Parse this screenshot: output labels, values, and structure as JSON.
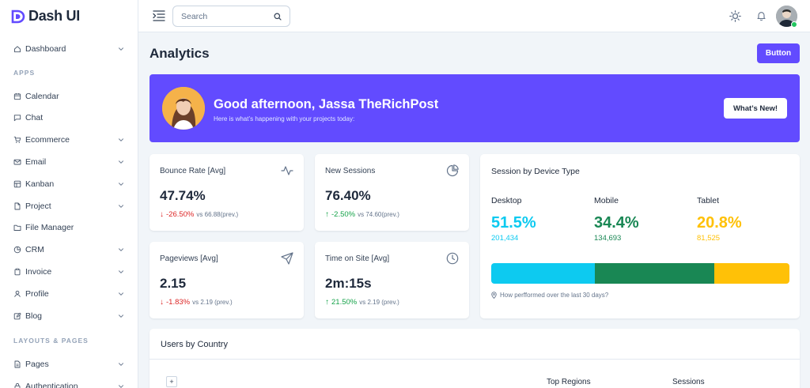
{
  "brand": {
    "name": "Dash UI"
  },
  "sidebar": {
    "items": [
      {
        "label": "Dashboard",
        "icon": "home-icon",
        "has_children": true
      },
      {
        "section": "APPS"
      },
      {
        "label": "Calendar",
        "icon": "calendar-icon",
        "has_children": false
      },
      {
        "label": "Chat",
        "icon": "chat-icon",
        "has_children": false
      },
      {
        "label": "Ecommerce",
        "icon": "cart-icon",
        "has_children": true
      },
      {
        "label": "Email",
        "icon": "mail-icon",
        "has_children": true
      },
      {
        "label": "Kanban",
        "icon": "kanban-icon",
        "has_children": true
      },
      {
        "label": "Project",
        "icon": "file-icon",
        "has_children": true
      },
      {
        "label": "File Manager",
        "icon": "folder-icon",
        "has_children": false
      },
      {
        "label": "CRM",
        "icon": "pie-icon",
        "has_children": true
      },
      {
        "label": "Invoice",
        "icon": "clipboard-icon",
        "has_children": true
      },
      {
        "label": "Profile",
        "icon": "user-icon",
        "has_children": true
      },
      {
        "label": "Blog",
        "icon": "edit-icon",
        "has_children": true
      },
      {
        "section": "LAYOUTS & PAGES"
      },
      {
        "label": "Pages",
        "icon": "page-icon",
        "has_children": true
      },
      {
        "label": "Authentication",
        "icon": "lock-icon",
        "has_children": true
      }
    ]
  },
  "topbar": {
    "search_placeholder": "Search"
  },
  "page": {
    "title": "Analytics",
    "button_label": "Button"
  },
  "hero": {
    "greeting": "Good afternoon, Jassa TheRichPost",
    "subtitle": "Here is what’s happening with your projects today:",
    "button_label": "What’s New!"
  },
  "stats": [
    {
      "label": "Bounce Rate [Avg]",
      "value": "47.74%",
      "change": "-26.50%",
      "prev": "vs 66.88(prev.)",
      "trend": "down",
      "icon": "activity-icon"
    },
    {
      "label": "New Sessions",
      "value": "76.40%",
      "change": "-2.50%",
      "prev": "vs 74.60(prev.)",
      "trend": "up",
      "icon": "pie-chart-icon"
    },
    {
      "label": "Pageviews [Avg]",
      "value": "2.15",
      "change": "-1.83%",
      "prev": "vs 2.19 (prev.)",
      "trend": "down",
      "icon": "send-icon"
    },
    {
      "label": "Time on Site [Avg]",
      "value": "2m:15s",
      "change": "21.50%",
      "prev": "vs 2.19 (prev.)",
      "trend": "up",
      "icon": "clock-icon"
    }
  ],
  "device": {
    "title": "Session by Device Type",
    "types": [
      {
        "name": "Desktop",
        "percent": "51.5%",
        "count": "201,434",
        "share": 34.8,
        "color": "#0dcaf0"
      },
      {
        "name": "Mobile",
        "percent": "34.4%",
        "count": "134,693",
        "share": 40.1,
        "color": "#198754"
      },
      {
        "name": "Tablet",
        "percent": "20.8%",
        "count": "81,525",
        "share": 25.1,
        "color": "#ffc107"
      }
    ],
    "note": "How perfformed over the last 30 days?"
  },
  "users_by_country": {
    "title": "Users by Country",
    "zoom_label": "+",
    "columns": [
      "Top Regions",
      "Sessions"
    ]
  },
  "colors": {
    "primary": "#624bff",
    "negative": "#dc2626",
    "positive": "#16a34a"
  }
}
